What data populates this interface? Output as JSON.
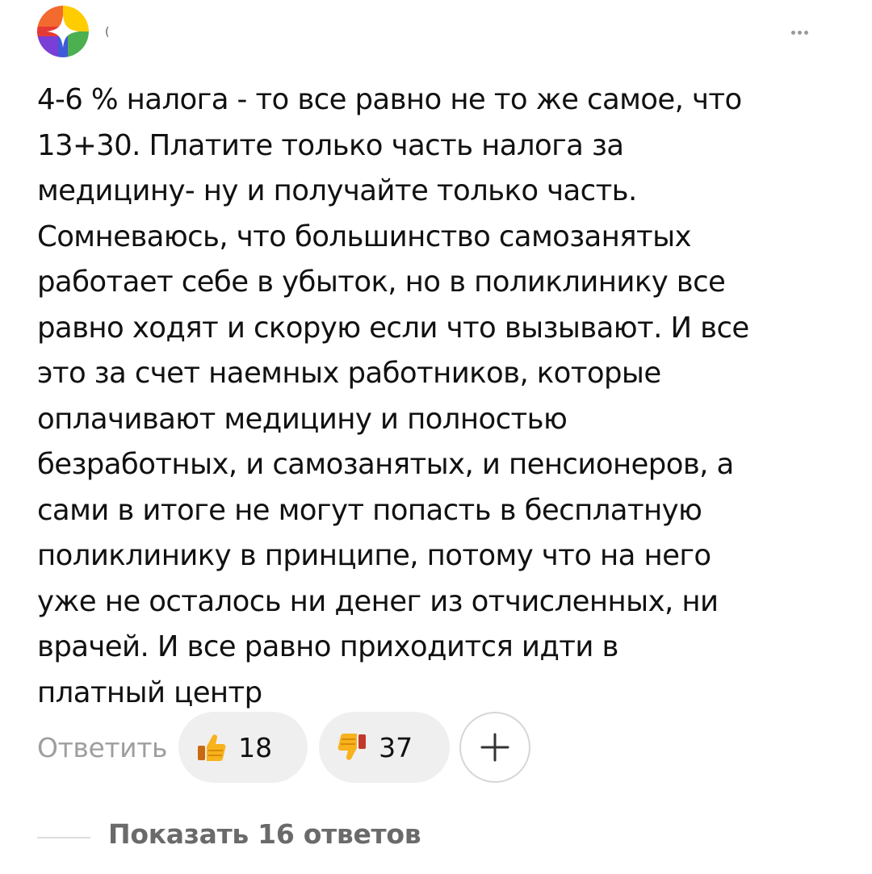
{
  "comment": {
    "author_initial": "(",
    "text": "4-6 % налога - то все равно не то же самое, что\n13+30. Платите только часть налога за\nмедицину- ну и получайте  только часть.\nСомневаюсь, что большинство самозанятых\nработает себе в убыток, но в поликлинику все\nравно ходят и скорую если что вызывают. И все\nэто за счет наемных работников, которые\nоплачивают медицину и полностью\nбезработных, и самозанятых, и пенсионеров, а\nсами в итоге не могут попасть в бесплатную\nполиклинику в принципе, потому что на него\nуже не осталось ни денег из отчисленных, ни\nврачей. И все равно приходится идти в\nплатный центр"
  },
  "actions": {
    "reply_label": "Ответить",
    "likes": "18",
    "dislikes": "37"
  },
  "replies": {
    "show_label": "Показать 16 ответов"
  },
  "icons": {
    "avatar": "multicolor-logo-avatar",
    "menu": "more-dots-icon",
    "like": "thumbs-up-icon",
    "dislike": "thumbs-down-icon",
    "add": "plus-icon"
  }
}
